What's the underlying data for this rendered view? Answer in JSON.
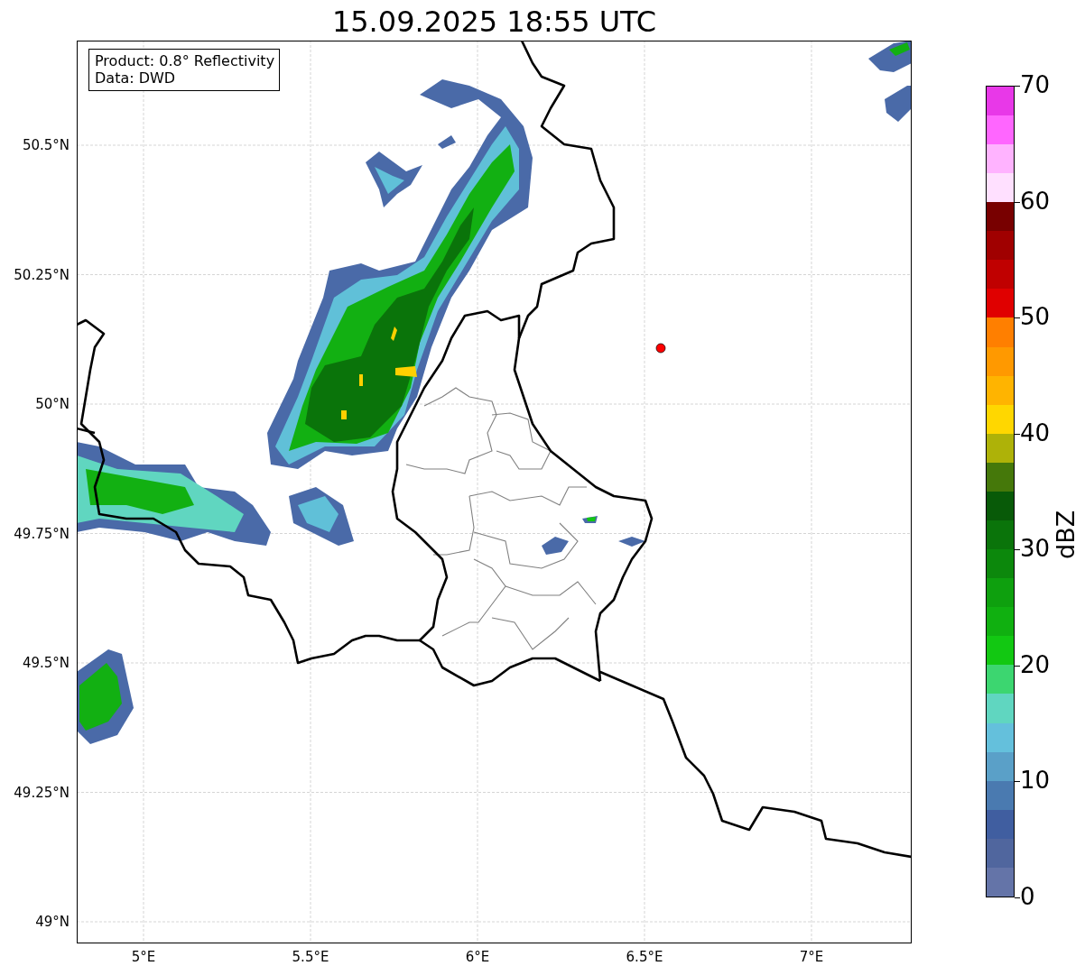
{
  "title": "15.09.2025 18:55 UTC",
  "info_box": {
    "lines": [
      "Product: 0.8° Reflectivity",
      "Data: DWD"
    ]
  },
  "map": {
    "lat_labels": [
      "50.5°N",
      "50.25°N",
      "50°N",
      "49.75°N",
      "49.5°N",
      "49.25°N",
      "49°N"
    ],
    "lon_labels": [
      "5°E",
      "5.5°E",
      "6°E",
      "6.5°E",
      "7°E"
    ]
  },
  "colorbar": {
    "label": "dBZ",
    "ticks": [
      "70",
      "60",
      "50",
      "40",
      "30",
      "20",
      "10",
      "0"
    ],
    "bins": [
      {
        "color": "#6474a8"
      },
      {
        "color": "#50669e"
      },
      {
        "color": "#405ea0"
      },
      {
        "color": "#4a7ab0"
      },
      {
        "color": "#5aa0c8"
      },
      {
        "color": "#64c0dc"
      },
      {
        "color": "#60d6c0"
      },
      {
        "color": "#3cd670"
      },
      {
        "color": "#12c812"
      },
      {
        "color": "#10b010"
      },
      {
        "color": "#0ea00e"
      },
      {
        "color": "#0c880c"
      },
      {
        "color": "#0a740a"
      },
      {
        "color": "#085a08"
      },
      {
        "color": "#45780a"
      },
      {
        "color": "#aeb208"
      },
      {
        "color": "#ffd700"
      },
      {
        "color": "#ffb400"
      },
      {
        "color": "#ff9900"
      },
      {
        "color": "#ff7f00"
      },
      {
        "color": "#e00000"
      },
      {
        "color": "#c00000"
      },
      {
        "color": "#a00000"
      },
      {
        "color": "#780000"
      },
      {
        "color": "#ffe0ff"
      },
      {
        "color": "#ffb3ff"
      },
      {
        "color": "#ff66ff"
      },
      {
        "color": "#e838e8"
      }
    ]
  }
}
